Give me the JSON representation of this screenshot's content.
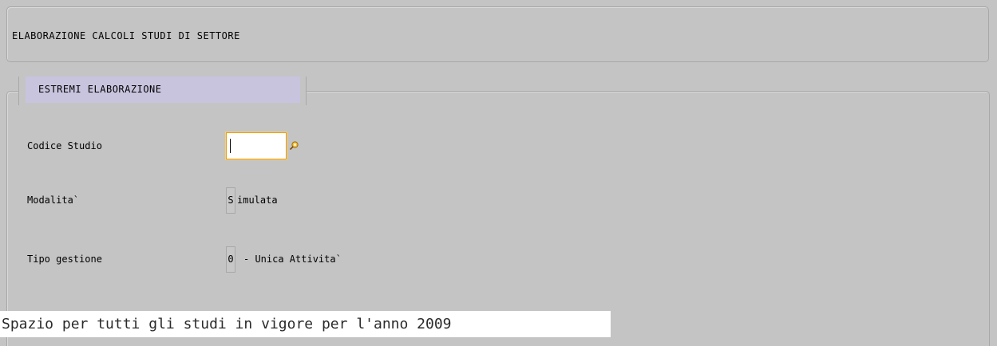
{
  "header": {
    "title": "ELABORAZIONE CALCOLI STUDI DI SETTORE"
  },
  "group": {
    "legend": "ESTREMI ELABORAZIONE"
  },
  "fields": {
    "codice_studio": {
      "label": "Codice Studio",
      "value": "",
      "lookup_icon": "lookup-icon"
    },
    "modalita": {
      "label": "Modalita`",
      "code": "S",
      "description": "imulata"
    },
    "tipo_gestione": {
      "label": "Tipo gestione",
      "code": "0",
      "description": "-  Unica Attivita`"
    }
  },
  "status_bar": {
    "message": "Spazio per tutti gli studi in vigore per l'anno 2009"
  },
  "colors": {
    "background": "#c4c4c4",
    "legend_background": "#c8c4de",
    "input_focus_border": "#e39a17",
    "status_background": "#ffffff"
  }
}
